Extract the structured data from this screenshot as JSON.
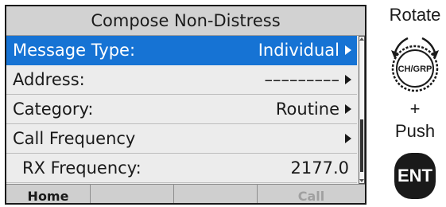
{
  "screen": {
    "title": "Compose Non-Distress",
    "menu": [
      {
        "label": "Message Type:",
        "value": "Individual",
        "arrow": true
      },
      {
        "label": "Address:",
        "value": "–––––––––",
        "arrow": true
      },
      {
        "label": "Category:",
        "value": "Routine",
        "arrow": true
      },
      {
        "label": "Call Frequency",
        "value": "",
        "arrow": true
      },
      {
        "label": "RX Frequency:",
        "value": "2177.0",
        "arrow": false
      }
    ],
    "softkeys": [
      "Home",
      "",
      "",
      "Call"
    ],
    "colors": {
      "selected_row": "#1673d4",
      "disabled_softkey": "#a0a0a0"
    }
  },
  "controls": {
    "rotate_label": "Rotate",
    "knob_label": "CH/GRP",
    "plus_label": "+",
    "push_label": "Push",
    "ent_label": "ENT"
  }
}
